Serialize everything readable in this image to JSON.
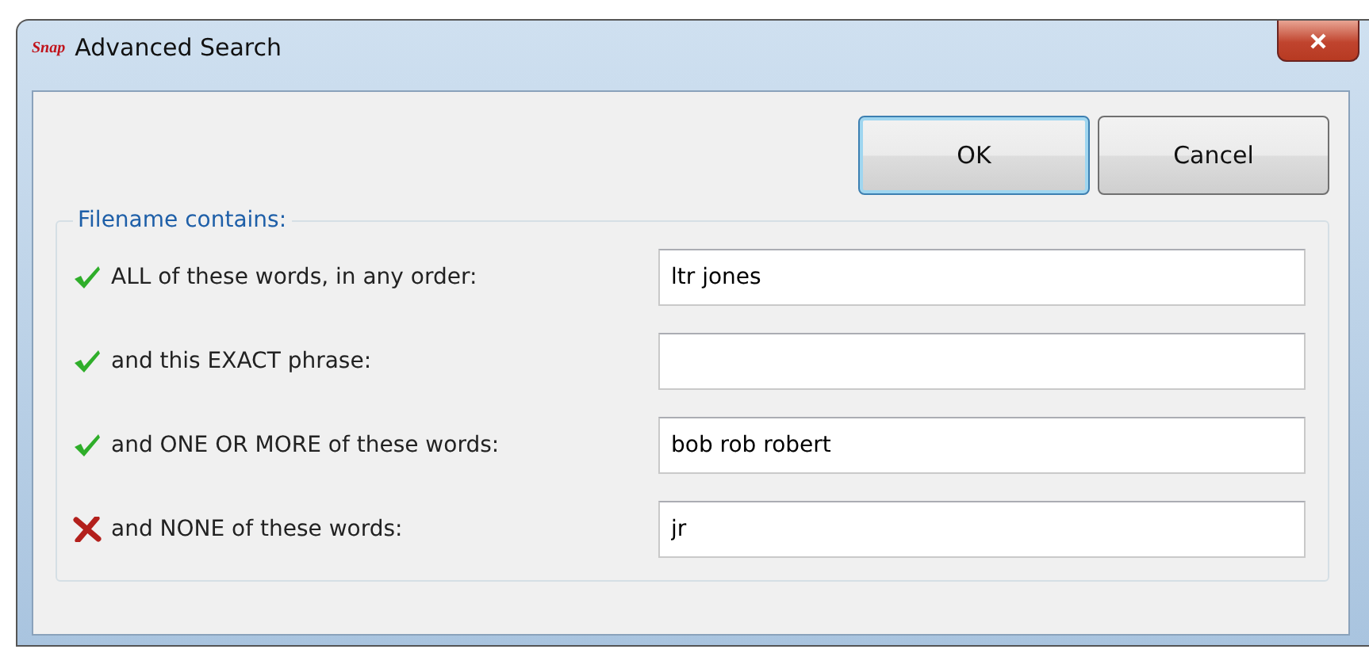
{
  "window": {
    "logo": "Snap",
    "title": "Advanced Search"
  },
  "buttons": [
    {
      "label": "OK",
      "default": true
    },
    {
      "label": "Cancel",
      "default": false
    }
  ],
  "group": {
    "legend": "Filename contains:",
    "rows": [
      {
        "kind": "check",
        "label": "ALL of these words, in any order:",
        "value": "ltr jones"
      },
      {
        "kind": "check",
        "label": "and this EXACT phrase:",
        "value": ""
      },
      {
        "kind": "check",
        "label": "and ONE OR MORE of these words:",
        "value": "bob rob robert"
      },
      {
        "kind": "cross",
        "label": "and NONE of these words:",
        "value": "jr"
      }
    ]
  }
}
